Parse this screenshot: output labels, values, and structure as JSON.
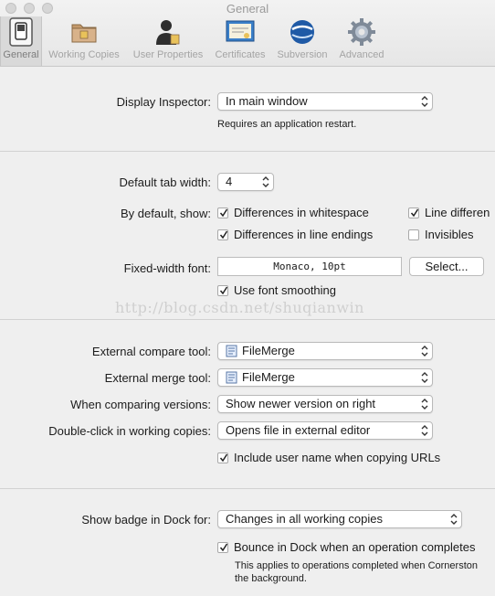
{
  "window": {
    "title": "General"
  },
  "toolbar": {
    "items": [
      {
        "label": "General",
        "icon": "switch-icon",
        "active": true
      },
      {
        "label": "Working Copies",
        "icon": "folder-icon",
        "active": false
      },
      {
        "label": "User Properties",
        "icon": "user-icon",
        "active": false
      },
      {
        "label": "Certificates",
        "icon": "certificate-icon",
        "active": false
      },
      {
        "label": "Subversion",
        "icon": "subversion-icon",
        "active": false
      },
      {
        "label": "Advanced",
        "icon": "gear-icon",
        "active": false
      }
    ]
  },
  "inspector": {
    "label": "Display Inspector:",
    "value": "In main window",
    "note": "Requires an application restart."
  },
  "diff": {
    "tab_width_label": "Default tab width:",
    "tab_width_value": "4",
    "show_label": "By default, show:",
    "whitespace": {
      "label": "Differences in whitespace",
      "checked": true
    },
    "line_diff": {
      "label": "Line differen",
      "checked": true
    },
    "line_endings": {
      "label": "Differences in line endings",
      "checked": true
    },
    "invisibles": {
      "label": "Invisibles",
      "checked": false
    },
    "font_label": "Fixed-width font:",
    "font_value": "Monaco, 10pt",
    "select_button": "Select...",
    "smoothing": {
      "label": "Use font smoothing",
      "checked": true
    }
  },
  "watermark": "http://blog.csdn.net/shuqianwin",
  "tools": {
    "compare_label": "External compare tool:",
    "compare_value": "FileMerge",
    "merge_label": "External merge tool:",
    "merge_value": "FileMerge",
    "versions_label": "When comparing versions:",
    "versions_value": "Show newer version on right",
    "dblclick_label": "Double-click in working copies:",
    "dblclick_value": "Opens file in external editor",
    "include_user": {
      "label": "Include user name when copying URLs",
      "checked": true
    }
  },
  "dock": {
    "badge_label": "Show badge in Dock for:",
    "badge_value": "Changes in all working copies",
    "bounce": {
      "label": "Bounce in Dock when an operation completes",
      "checked": true
    },
    "note_line1": "This applies to operations completed when Cornerston",
    "note_line2": "the background."
  },
  "colors": {
    "background": "#efefef",
    "toolbar_text": "#a4a4a4",
    "separator": "#d2d2d2"
  }
}
